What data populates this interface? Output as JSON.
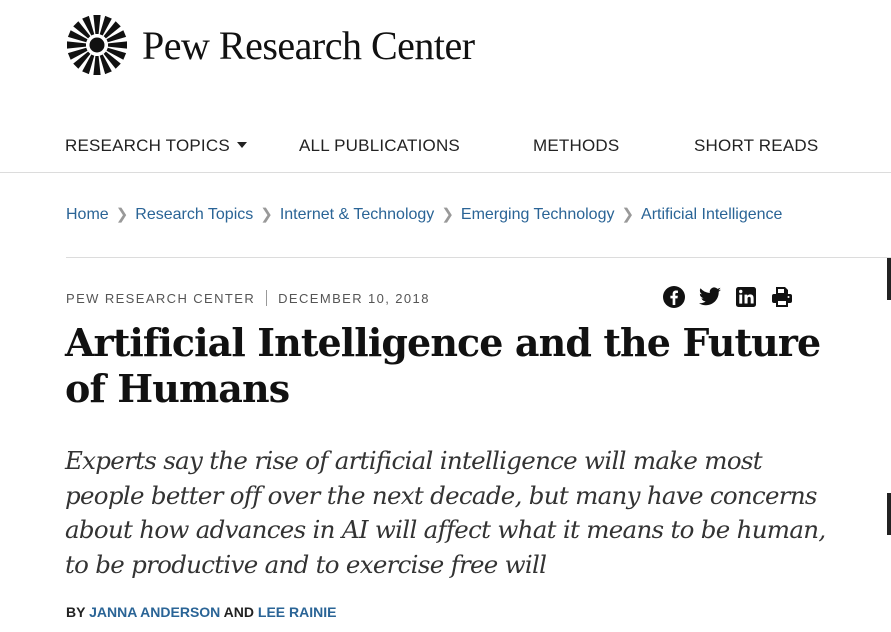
{
  "brand": {
    "name": "Pew Research Center",
    "logo_icon": "sunburst-logo-icon"
  },
  "nav": {
    "items": [
      {
        "label": "RESEARCH TOPICS",
        "has_dropdown": true
      },
      {
        "label": "ALL PUBLICATIONS"
      },
      {
        "label": "METHODS"
      },
      {
        "label": "SHORT READS"
      }
    ]
  },
  "breadcrumb": [
    "Home",
    "Research Topics",
    "Internet & Technology",
    "Emerging Technology",
    "Artificial Intelligence"
  ],
  "meta": {
    "source": "PEW RESEARCH CENTER",
    "date": "DECEMBER 10, 2018"
  },
  "share_icons": [
    "facebook-icon",
    "twitter-icon",
    "linkedin-icon",
    "print-icon"
  ],
  "article": {
    "title": "Artificial Intelligence and the Future of Humans",
    "dek": "Experts say the rise of artificial intelligence will make most people better off over the next decade, but many have concerns about how advances in AI will affect what it means to be human, to be productive and to exercise free will"
  },
  "byline": {
    "prefix": "BY",
    "author1": "JANNA ANDERSON",
    "joiner": "AND",
    "author2": "LEE RAINIE"
  },
  "colors": {
    "link": "#2a6496",
    "text": "#111111",
    "rule": "#dcdcdc"
  }
}
